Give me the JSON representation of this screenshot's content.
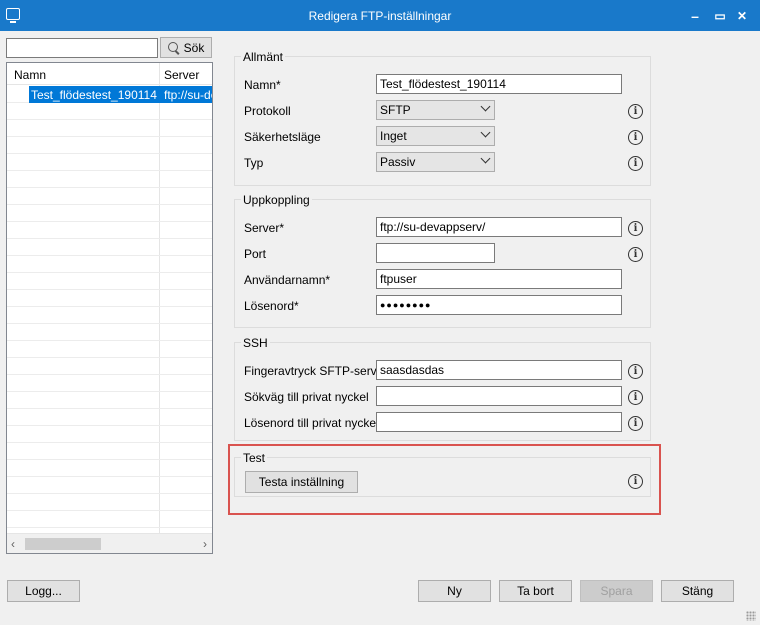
{
  "window": {
    "title": "Redigera FTP-inställningar",
    "controls": {
      "minimize": "–",
      "maximize": "▭",
      "close": "✕"
    }
  },
  "search": {
    "value": "",
    "button_label": "Sök"
  },
  "list": {
    "columns": [
      "Namn",
      "Server"
    ],
    "rows": [
      {
        "name": "Test_flödestest_190114",
        "server": "ftp://su-de"
      }
    ],
    "scroll_left": "‹",
    "scroll_right": "›"
  },
  "general": {
    "title": "Allmänt",
    "name_label": "Namn*",
    "name_value": "Test_flödestest_190114",
    "protocol_label": "Protokoll",
    "protocol_value": "SFTP",
    "security_label": "Säkerhetsläge",
    "security_value": "Inget",
    "type_label": "Typ",
    "type_value": "Passiv"
  },
  "connection": {
    "title": "Uppkoppling",
    "server_label": "Server*",
    "server_value": "ftp://su-devappserv/",
    "port_label": "Port",
    "port_value": "",
    "user_label": "Användarnamn*",
    "user_value": "ftpuser",
    "password_label": "Lösenord*",
    "password_value": "●●●●●●●●"
  },
  "ssh": {
    "title": "SSH",
    "fingerprint_label": "Fingeravtryck SFTP-server",
    "fingerprint_value": "saasdasdas",
    "keypath_label": "Sökväg till privat nyckel",
    "keypath_value": "",
    "keypass_label": "Lösenord till privat nyckel",
    "keypass_value": ""
  },
  "test": {
    "title": "Test",
    "button_label": "Testa inställning"
  },
  "info_glyph": "i",
  "footer": {
    "log": "Logg...",
    "new": "Ny",
    "delete": "Ta bort",
    "save": "Spara",
    "close": "Stäng"
  },
  "colors": {
    "titlebar": "#1979ca",
    "selection": "#0078d7",
    "highlight": "#d9534f"
  }
}
